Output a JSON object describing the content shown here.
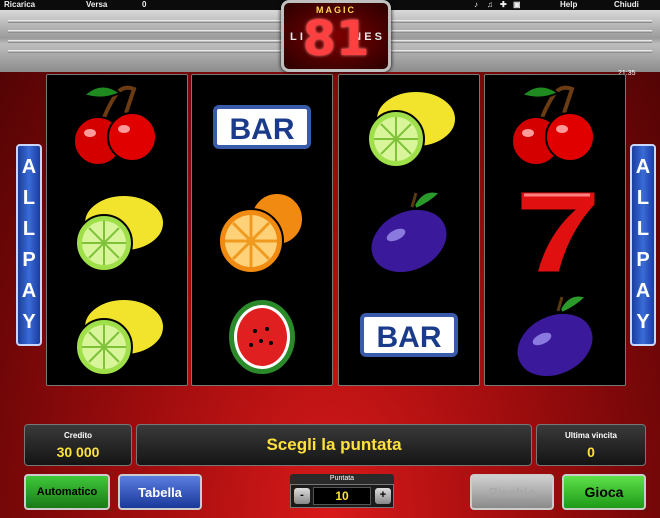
{
  "top_bar": {
    "ricarica_label": "Ricarica",
    "versa_label": "Versa",
    "versa_value": "0",
    "help_label": "Help",
    "chiudi_label": "Chiudi"
  },
  "logo": {
    "magic": "MAGIC",
    "number": "81",
    "lines_letters": [
      "L",
      "I",
      "N",
      "E",
      "S"
    ]
  },
  "clock": "21:35",
  "allpay_letters": [
    "A",
    "L",
    "L",
    "P",
    "A",
    "Y"
  ],
  "reels": [
    {
      "symbols": [
        "cherry",
        "lemon",
        "lemon"
      ]
    },
    {
      "symbols": [
        "bar",
        "orange",
        "watermelon"
      ]
    },
    {
      "symbols": [
        "lemon",
        "plum",
        "bar"
      ]
    },
    {
      "symbols": [
        "cherry",
        "seven",
        "plum"
      ]
    }
  ],
  "bar_text": "BAR",
  "credit": {
    "label": "Credito",
    "value": "30 000"
  },
  "message": "Scegli la puntata",
  "last_win": {
    "label": "Ultima vincita",
    "value": "0"
  },
  "buttons": {
    "automatic": "Automatico",
    "table": "Tabella",
    "risk": "Rischio",
    "play": "Gioca"
  },
  "bet": {
    "label": "Puntata",
    "value": "10",
    "minus": "-",
    "plus": "+"
  },
  "colors": {
    "accent_red": "#d8191a",
    "text_yellow": "#ffe13b",
    "allpay_blue": "#2a55c4",
    "play_green": "#3bbf2a"
  }
}
